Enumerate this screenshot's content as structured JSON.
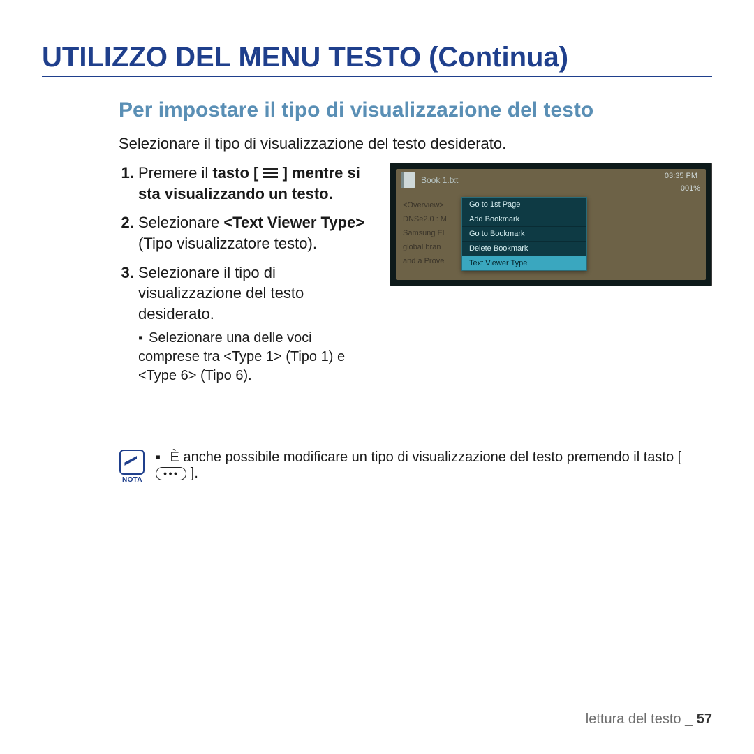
{
  "title": "UTILIZZO DEL MENU TESTO (Continua)",
  "subtitle": "Per impostare il tipo di visualizzazione del testo",
  "intro": "Selezionare il tipo di visualizzazione del testo desiderato.",
  "steps": {
    "s1_a": "Premere il ",
    "s1_b": "tasto",
    "s1_c": " [ ",
    "s1_d": " ] mentre si sta visualizzando un testo.",
    "s2_a": "Selezionare ",
    "s2_b": "<Text Viewer Type>",
    "s2_c": " (Tipo visualizzatore testo).",
    "s3_a": "Selezionare il tipo di visualizzazione del testo desiderato.",
    "s3_sub": "Selezionare una delle voci comprese tra <Type 1> (Tipo 1) e <Type 6> (Tipo 6)."
  },
  "device": {
    "filename": "Book 1.txt",
    "time": "03:35 PM",
    "percent": "001%",
    "bgtext": "<Overview>\nDNSe2.0 : M\nSamsung El                                       est growing\nglobal bran                                        \nand a Prove                                        munication,",
    "menu": {
      "i0": "Go to 1st Page",
      "i1": "Add Bookmark",
      "i2": "Go to Bookmark",
      "i3": "Delete Bookmark",
      "i4": "Text Viewer Type"
    }
  },
  "note": {
    "label": "NOTA",
    "text_a": "È anche possibile modificare un tipo di visualizzazione del testo premendo il tasto [ ",
    "text_b": " ]."
  },
  "footer": {
    "section": "lettura del testo _ ",
    "page": "57"
  }
}
